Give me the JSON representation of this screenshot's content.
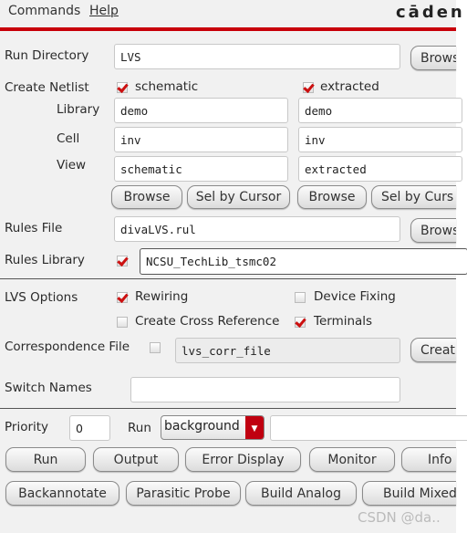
{
  "menu": {
    "commands": "Commands",
    "help": "Help"
  },
  "logo": "cāden",
  "accent_color": "#c8000a",
  "run_directory": {
    "label": "Run Directory",
    "value": "LVS",
    "browse": "Brows"
  },
  "create_netlist": {
    "label": "Create Netlist",
    "schematic": {
      "label": "schematic",
      "checked": true
    },
    "extracted": {
      "label": "extracted",
      "checked": true
    },
    "library": {
      "label": "Library",
      "schematic": "demo",
      "extracted": "demo"
    },
    "cell": {
      "label": "Cell",
      "schematic": "inv",
      "extracted": "inv"
    },
    "view": {
      "label": "View",
      "schematic": "schematic",
      "extracted": "extracted"
    },
    "buttons": [
      "Browse",
      "Sel by Cursor",
      "Browse",
      "Sel by Curs"
    ]
  },
  "rules_file": {
    "label": "Rules File",
    "value": "divaLVS.rul",
    "browse": "Brows"
  },
  "rules_library": {
    "label": "Rules Library",
    "checked": true,
    "value": "NCSU_TechLib_tsmc02"
  },
  "lvs_options": {
    "label": "LVS Options",
    "rewiring": {
      "label": "Rewiring",
      "checked": true
    },
    "device_fixing": {
      "label": "Device Fixing",
      "checked": false
    },
    "cross_reference": {
      "label": "Create Cross Reference",
      "checked": false
    },
    "terminals": {
      "label": "Terminals",
      "checked": true
    }
  },
  "correspondence_file": {
    "label": "Correspondence File",
    "checked": false,
    "value": "lvs_corr_file",
    "create": "Creat"
  },
  "switch_names": {
    "label": "Switch Names",
    "value": ""
  },
  "priority": {
    "label": "Priority",
    "value": "0"
  },
  "run_mode": {
    "label": "Run",
    "selected": "background",
    "extra": ""
  },
  "actions_row1": [
    "Run",
    "Output",
    "Error Display",
    "Monitor",
    "Info"
  ],
  "actions_row2": [
    "Backannotate",
    "Parasitic Probe",
    "Build Analog",
    "Build Mixed"
  ],
  "watermark": "CSDN @da.."
}
